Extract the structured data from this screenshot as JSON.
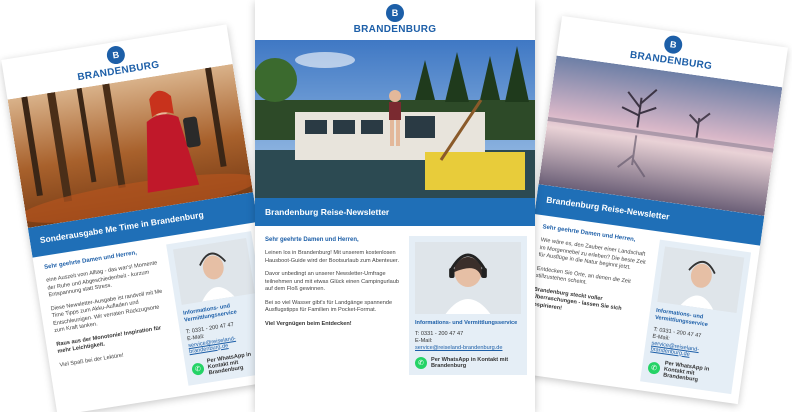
{
  "brand": {
    "logo_text": "BRANDENBURG",
    "logo_mark": "B"
  },
  "colors": {
    "brand_blue": "#1d5fa8",
    "banner_blue": "#1f6fb7",
    "contact_bg": "#e5eef6",
    "whatsapp": "#25d366"
  },
  "cards": {
    "left": {
      "banner": "Sonderausgabe Me Time in Brandenburg",
      "greeting": "Sehr geehrte Damen und Herren,",
      "paragraphs": [
        "eine Auszeit vom Alltag - das war's! Momente der Ruhe und Abgeschiedenheit - kurzum Entspannung statt Stress.",
        "Diese Newsletter-Ausgabe ist randvoll mit Me Time Tipps zum Akku-Aufladen und Entschleunigen. Wir verraten Rückzugsorte zum Kraft tanken.",
        "Raus aus der Monotonie! Inspiration für mehr Leichtigkeit.",
        "Viel Spaß bei der Lektüre!"
      ],
      "contact_title": "Informations- und Vermittlungsservice",
      "phone": "T: 0331 - 200 47 47",
      "email_label": "E-Mail:",
      "email": "service@reiseland-brandenburg.de",
      "whatsapp_label": "Per WhatsApp in Kontakt mit Brandenburg"
    },
    "center": {
      "banner": "Brandenburg Reise-Newsletter",
      "greeting": "Sehr geehrte Damen und Herren,",
      "paragraphs": [
        "Leinen los in Brandenburg! Mit unserem kostenlosen Hausboot-Guide wird der Bootsurlaub zum Abenteuer.",
        "Davor unbedingt an unserer Newsletter-Umfrage teilnehmen und mit etwas Glück einen Campingurlaub auf dem Floß gewinnen.",
        "Bei so viel Wasser gibt's für Landgänge spannende Ausflugstipps für Familien im Pocket-Format.",
        "Viel Vergnügen beim Entdecken!"
      ],
      "contact_title": "Informations- und Vermittlungsservice",
      "phone": "T: 0331 - 200 47 47",
      "email_label": "E-Mail:",
      "email": "service@reiseland-brandenburg.de",
      "whatsapp_label": "Per WhatsApp in Kontakt mit Brandenburg"
    },
    "right": {
      "banner": "Brandenburg Reise-Newsletter",
      "greeting": "Sehr geehrte Damen und Herren,",
      "paragraphs": [
        "Wie wäre es, den Zauber einer Landschaft im Morgennebel zu erleben? Die beste Zeit für Ausflüge in die Natur beginnt jetzt.",
        "Entdecken Sie Orte, an denen die Zeit stillzustehen scheint.",
        "Brandenburg steckt voller Überraschungen - lassen Sie sich inspirieren!"
      ],
      "contact_title": "Informations- und Vermittlungsservice",
      "phone": "T: 0331 - 200 47 47",
      "email_label": "E-Mail:",
      "email": "service@reiseland-brandenburg.de",
      "whatsapp_label": "Per WhatsApp in Kontakt mit Brandenburg"
    }
  },
  "icons": {
    "logo": "brandenburg-eagle-icon",
    "whatsapp": "whatsapp-icon"
  }
}
